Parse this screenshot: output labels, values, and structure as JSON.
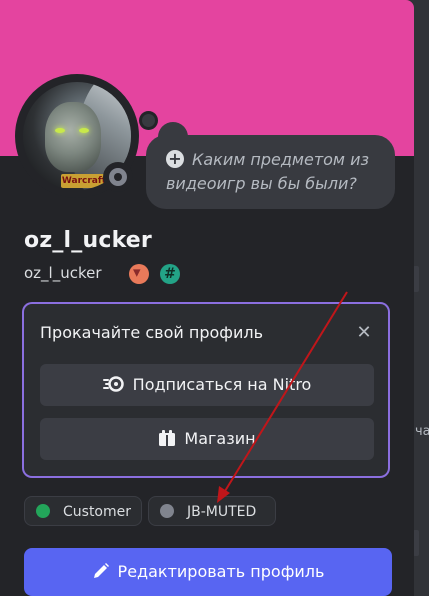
{
  "bubble": {
    "text": "Каким предметом из видеоигр вы бы были?"
  },
  "profile": {
    "display_name": "oz_l_ucker",
    "username": "oz_l_ucker",
    "avatar_logo": "Warcraft"
  },
  "nitro_card": {
    "title": "Прокачайте свой профиль",
    "subscribe_label": "Подписаться на Nitro",
    "shop_label": "Магазин"
  },
  "roles": [
    {
      "name": "Customer",
      "color": "#23a55a"
    },
    {
      "name": "JB-MUTED",
      "color": "#80848e"
    }
  ],
  "edit_button": {
    "label": "Редактировать профиль"
  },
  "background": {
    "right_text": "ча"
  },
  "colors": {
    "banner": "#e4449f",
    "accent": "#5865f2",
    "card_border": "#8b6fe0",
    "arrow": "#c0161a"
  },
  "icons": {
    "bubble_add": "plus-circle-icon",
    "nitro_close": "close-icon",
    "subscribe": "nitro-icon",
    "shop": "shop-icon",
    "edit": "pencil-icon",
    "status": "offline-status-icon"
  }
}
